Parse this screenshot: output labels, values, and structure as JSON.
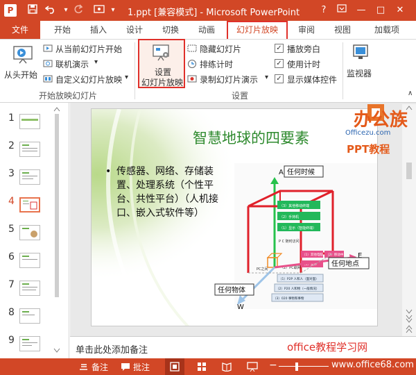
{
  "titlebar": {
    "app_icon": "P",
    "title": "1.ppt [兼容模式] - Microsoft PowerPoint",
    "help": "?",
    "minimize": "—",
    "restore": "□",
    "close": "✕",
    "quick_access_icons": [
      "save-icon",
      "undo-icon",
      "redo-icon",
      "touch-mode-icon",
      "customize-icon"
    ]
  },
  "tabs": {
    "file": "文件",
    "items": [
      "开始",
      "插入",
      "设计",
      "切换",
      "动画",
      "幻灯片放映",
      "审阅",
      "视图",
      "加载项"
    ],
    "active": "幻灯片放映"
  },
  "ribbon": {
    "from_start": "从头开始",
    "from_current": "从当前幻灯片开始",
    "present_online": "联机演示",
    "custom_show": "自定义幻灯片放映",
    "group1": "开始放映幻灯片",
    "setup_line1": "设置",
    "setup_line2": "幻灯片放映",
    "hide_slide": "隐藏幻灯片",
    "rehearse": "排练计时",
    "record": "录制幻灯片演示",
    "play_narrations": "播放旁白",
    "use_timings": "使用计时",
    "show_media": "显示媒体控件",
    "group2": "设置",
    "monitors": "监视器"
  },
  "thumbnails": {
    "numbers": [
      "1",
      "2",
      "3",
      "4",
      "5",
      "6",
      "7",
      "8",
      "9"
    ],
    "selected": "4"
  },
  "slide": {
    "title": "智慧地球的四要素",
    "bullet": "•",
    "body": "传感器、网络、存储装置、处理系统（个性平台、共性平台）（人机接口、嵌入式软件等）",
    "diagram": {
      "label_a": "A",
      "label_when": "任何时候",
      "label_e": "E",
      "label_where": "任何地点",
      "label_w": "W",
      "label_what": "任何物体",
      "green_items": [
        "（3）其他移动终端",
        "（2）手持机",
        "（1）显示（智能终端）"
      ],
      "pink_items": [
        "（1）其他电脑",
        "（2）移动中",
        "（3）室外"
      ],
      "blue_items": [
        "（1）P2P  人和人（面对面）",
        "（2）P20  人和物（一般情况）",
        "（3）020  事物和事物"
      ],
      "center_labels": [
        "P C 随时访问",
        "PC之间",
        "（2）PC联网"
      ]
    }
  },
  "notes": {
    "placeholder": "单击此处添加备注"
  },
  "statusbar": {
    "notes": "备注",
    "comments": "批注"
  },
  "watermarks": {
    "brand": "办公族",
    "site": "Officezu.com",
    "ppt": "PPT教程",
    "footer_title": "office教程学习网",
    "footer_url": "www.office68.com"
  },
  "colors": {
    "accent": "#d24726",
    "highlight": "#e0302a",
    "slide_title": "#2e8a2e"
  }
}
